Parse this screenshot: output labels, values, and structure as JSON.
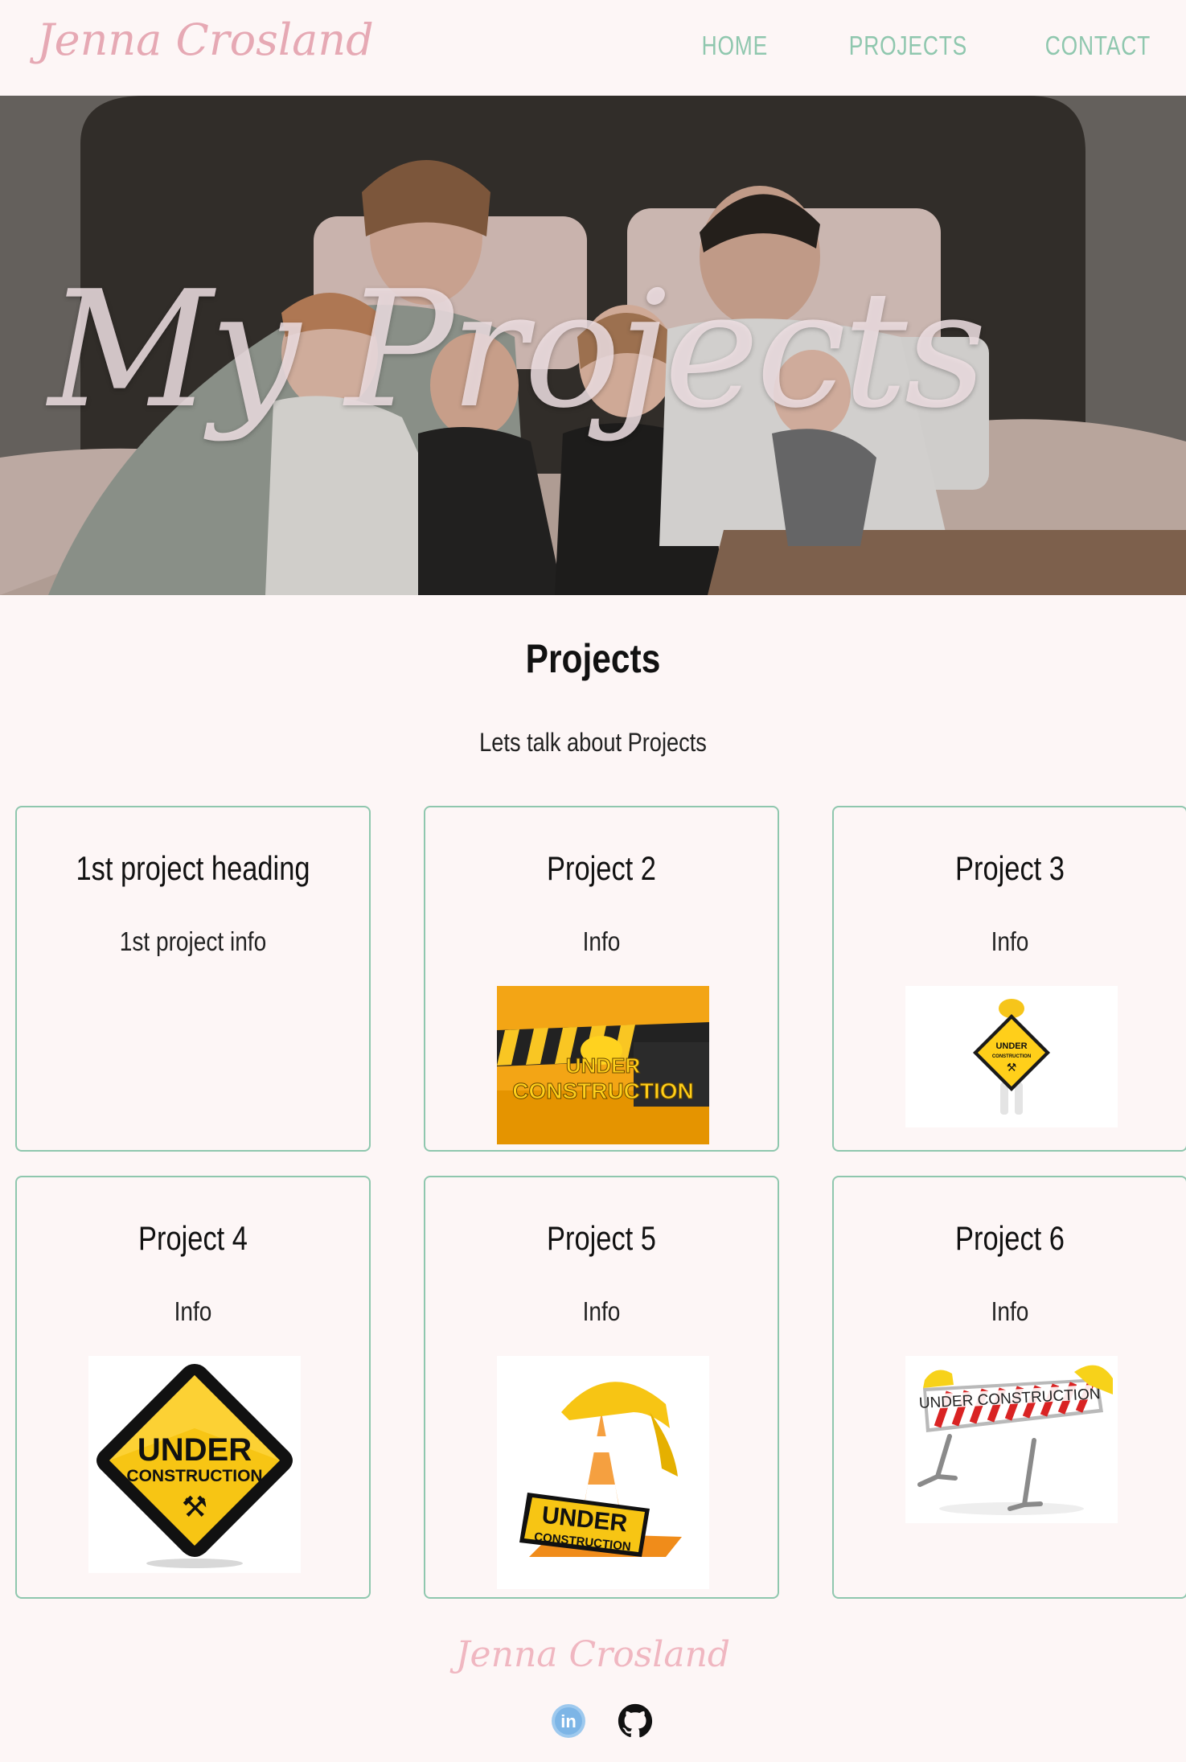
{
  "brand": "Jenna Crosland",
  "nav": {
    "home": "HOME",
    "projects": "PROJECTS",
    "contact": "CONTACT"
  },
  "hero": {
    "title": "My Projects"
  },
  "section": {
    "title": "Projects",
    "subtitle": "Lets talk about Projects"
  },
  "projects": [
    {
      "title": "1st project heading",
      "info": "1st project info",
      "image": "none"
    },
    {
      "title": "Project 2",
      "info": "Info",
      "image": "under-construction-banner"
    },
    {
      "title": "Project 3",
      "info": "Info",
      "image": "under-construction-figure-sign"
    },
    {
      "title": "Project 4",
      "info": "Info",
      "image": "under-construction-diamond-sign"
    },
    {
      "title": "Project 5",
      "info": "Info",
      "image": "under-construction-cone-hat"
    },
    {
      "title": "Project 6",
      "info": "Info",
      "image": "under-construction-barrier"
    }
  ],
  "image_text": {
    "p2_line1": "UNDER",
    "p2_line2": "CONSTRUCTION",
    "p3_line1": "UNDER",
    "p3_line2": "CONSTRUCTION",
    "p4_line1": "UNDER",
    "p4_line2": "CONSTRUCTION",
    "p5_line1": "UNDER",
    "p5_line2": "CONSTRUCTION",
    "p6_line1": "UNDER CONSTRUCTION"
  },
  "footer": {
    "brand": "Jenna Crosland",
    "linkedin_label": "in",
    "icons": [
      "linkedin-icon",
      "github-icon"
    ]
  },
  "colors": {
    "accent": "#8fc7ae",
    "brand_pink": "#e6a9b4",
    "background": "#fdf6f6"
  }
}
